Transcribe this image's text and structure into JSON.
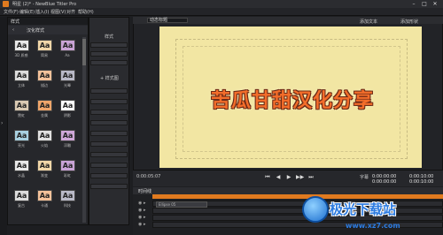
{
  "window": {
    "title": "明星 (2)* - NewBlue Titler Pro"
  },
  "menu": [
    "文件(F)",
    "编辑(E)",
    "插入(I)",
    "视图(V)",
    "对齐",
    "帮助(H)"
  ],
  "library": {
    "header": "样式",
    "breadcrumb": "汉化样式",
    "items": [
      {
        "label": "3D 质感",
        "glyph": "Aa"
      },
      {
        "label": "简易",
        "glyph": "Aa"
      },
      {
        "label": "Aa",
        "glyph": "Aa"
      },
      {
        "label": "立体",
        "glyph": "Aa"
      },
      {
        "label": "描边",
        "glyph": "Aa"
      },
      {
        "label": "光晕",
        "glyph": "Aa"
      },
      {
        "label": "霓虹",
        "glyph": "Aa"
      },
      {
        "label": "金属",
        "glyph": "Aa"
      },
      {
        "label": "阴影",
        "glyph": "Aa"
      },
      {
        "label": "亮光",
        "glyph": "Aa"
      },
      {
        "label": "火焰",
        "glyph": "Aa"
      },
      {
        "label": "浮雕",
        "glyph": "Aa"
      },
      {
        "label": "水晶",
        "glyph": "Aa"
      },
      {
        "label": "渐变",
        "glyph": "Aa"
      },
      {
        "label": "彩虹",
        "glyph": "Aa"
      },
      {
        "label": "复古",
        "glyph": "Aa"
      },
      {
        "label": "卡通",
        "glyph": "Aa"
      },
      {
        "label": "科技",
        "glyph": "Aa"
      }
    ]
  },
  "props": {
    "label": "样式",
    "button": "+ 样式图"
  },
  "preview": {
    "mode": "动态标题",
    "add_text": "添加文本",
    "add_shape": "添加形状",
    "title_text": "苦瓜甘甜汉化分享"
  },
  "transport": {
    "time_left": "0:00:05:07",
    "cue_label": "字幕",
    "tc_in": "0:00:00:00",
    "tc_out": "0:00:10:00",
    "tc_in2": "0:00:00:00",
    "tc_out2": "0:00:10:00",
    "buttons": [
      "⏮",
      "◀",
      "▶",
      "▶▶",
      "⏭"
    ]
  },
  "timeline": {
    "label": "时间线",
    "clip_label": "Ellipse 05"
  },
  "watermark": {
    "text": "极光下载站",
    "url": "www.xz7.com"
  }
}
